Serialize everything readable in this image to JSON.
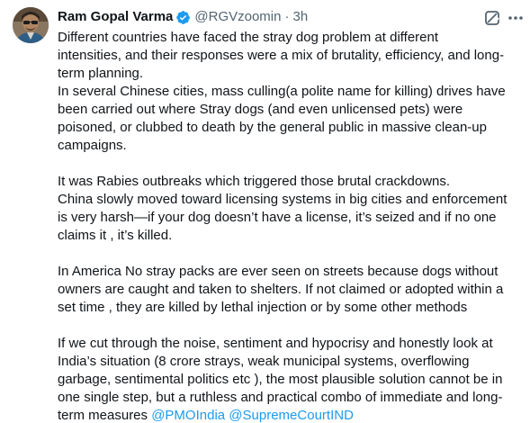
{
  "author": {
    "display_name": "Ram Gopal Varma",
    "handle": "@RGVzoomin",
    "separator": "·",
    "time": "3h"
  },
  "icons": {
    "verified": "verified-badge-icon",
    "grok": "grok-icon",
    "more": "more-options-icon",
    "accent": "#1d9bf0"
  },
  "body": {
    "p1": [
      "Different countries have faced the stray dog problem at different",
      "intensities, and their responses were a mix of brutality, efficiency, and long-",
      "term planning.",
      "In several Chinese cities, mass culling(a polite name for killing)  drives have",
      "been carried out where Stray dogs (and even unlicensed pets) were",
      "poisoned, or clubbed to death by the general public in massive clean-up",
      "campaigns."
    ],
    "p2": [
      "It was Rabies outbreaks which triggered those brutal crackdowns.",
      "China slowly moved toward licensing systems in big cities and enforcement",
      "is very harsh—if your dog doesn’t have a license, it’s seized and if no one",
      "claims it , it’s killed."
    ],
    "p3": [
      "In America No stray packs are ever seen on streets because dogs without",
      "owners are caught and taken to shelters. If not claimed or adopted within a",
      "set time , they are killed by lethal injection or by some other methods"
    ],
    "p4": [
      "If we cut through the noise, sentiment and hypocrisy and honestly look at",
      "India’s situation  (8 crore strays, weak municipal systems, overflowing",
      "garbage, sentimental politics etc ), the most plausible solution cannot be in",
      "one single step, but a ruthless  and practical combo of immediate and long-"
    ],
    "last_line_prefix": "term measures ",
    "mentions": [
      "@PMOIndia",
      "@SupremeCourtIND"
    ]
  }
}
